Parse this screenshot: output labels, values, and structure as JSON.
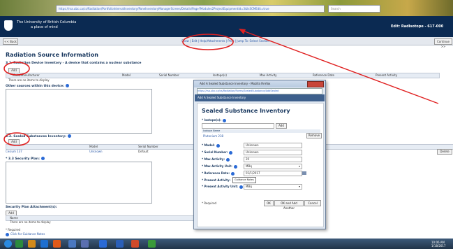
{
  "browser": {
    "address_url": "https://rsa.ubc.ca/cs/Radiation/PortfolioIntervalInventory/PaneInventoryManagerScreen/Details/Page?Modules2ProjectEquipmentId=3&IsSCMEdit=true",
    "search_placeholder": "Search"
  },
  "header": {
    "university_line1": "The University of British Columbia",
    "university_line2": "a place of mind",
    "edit_label": "Edit: RadIsotope - 617-000"
  },
  "toolbar": {
    "back_label": "<< Back",
    "links": "Show | Edit | Help/Attachments | Print | Jump To:  Select Section",
    "continue_label": "Continue >>"
  },
  "page": {
    "title": "Radiation Source Information",
    "section1_title": "3.1. Radiation Device Inventory - A device that contains a nuclear substance",
    "add_label": "Add",
    "table1_headers": [
      "Make/Manufacturer",
      "Model",
      "Serial Number",
      "Isotope(s)",
      "Max Activity",
      "Reference Date",
      "Present Activity"
    ],
    "table1_empty": "There are no items to display",
    "other_sources_label": "Other sources within this device:",
    "section2_title": "3.2. Sealed Substances Inventory:",
    "table2_headers": [
      "",
      "Model",
      "Serial Number"
    ],
    "table2_row": [
      "Cesium 137",
      "Unknown",
      "Default"
    ],
    "delete_label": "Delete",
    "security_plan_label": "* 3.3 Security Plan:",
    "security_attach_label": "Security Plan Attachment(s):",
    "attach_header": "Name",
    "attach_empty": "There are no items to display",
    "required_note": "* Required",
    "guidance_note": "Click for Guidance Notes"
  },
  "popup": {
    "window_title": "Add A Sealed Substance Inventory - Mozilla Firefox",
    "address": "https://rsa.ubc.ca/cs/Radiation/Forms/SealedSubstance/AddSealed",
    "bar_title": "Add A Sealed Substance Inventory",
    "heading": "Sealed Substance Inventory",
    "isotope_label": "* Isotope(s):",
    "add_label": "Add",
    "isotope_col": "Isotope Name",
    "isotope_value": "Plutonium 238",
    "remove_label": "Remove",
    "fields": [
      {
        "label": "* Model:",
        "value": "Unknown"
      },
      {
        "label": "* Serial Number:",
        "value": "Unknown"
      },
      {
        "label": "* Max Activity:",
        "value": "20"
      },
      {
        "label": "* Max Activity Unit:",
        "value": "MBq"
      },
      {
        "label": "* Reference Date:",
        "value": "01/1/2017"
      },
      {
        "label": "* Present Activity:",
        "value": "Guidance Notes"
      },
      {
        "label": "* Present Activity Unit:",
        "value": "MBq"
      }
    ],
    "required_note": "* Required",
    "ok_label": "OK",
    "ok_add_label": "OK and Add Another",
    "cancel_label": "Cancel"
  },
  "taskbar": {
    "time": "10:06 AM",
    "date": "1/18/2017"
  },
  "colors": {
    "header_bg": "#0b2a52",
    "annotation_red": "#e02020",
    "link_blue": "#2858a8"
  }
}
